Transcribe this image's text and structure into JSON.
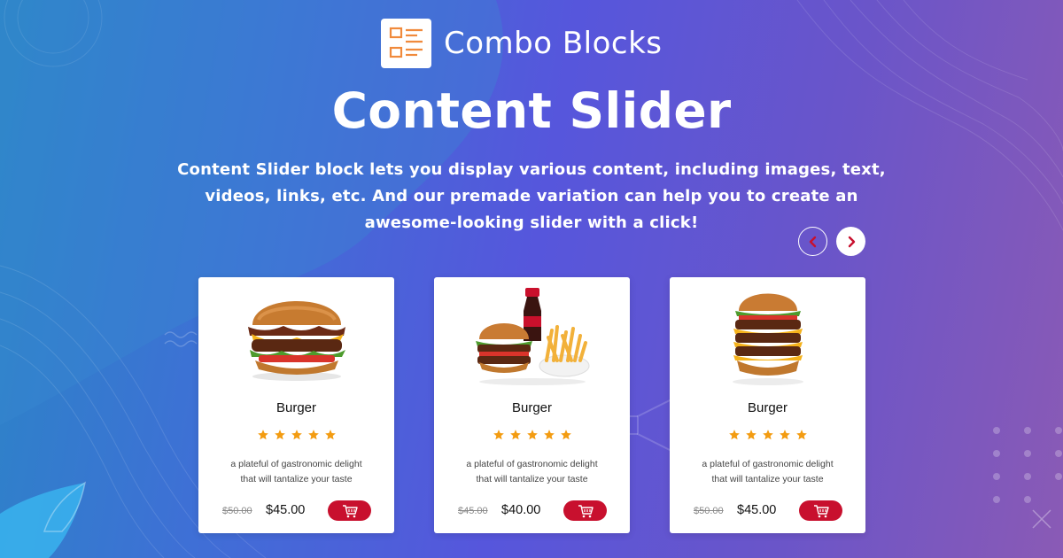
{
  "brand": {
    "name": "Combo Blocks",
    "logo_icon": "layout-blocks-icon"
  },
  "hero": {
    "title": "Content Slider",
    "description": "Content Slider block lets you display various content, including images, text, videos, links, etc. And our premade variation can help you to create an awesome-looking slider with a click!"
  },
  "slider_nav": {
    "prev_icon": "chevron-left-icon",
    "next_icon": "chevron-right-icon"
  },
  "colors": {
    "accent": "#c8102e",
    "star": "#f39c12",
    "card_bg": "#ffffff"
  },
  "cards": [
    {
      "title": "Burger",
      "rating": 5,
      "description_line1": "a plateful of gastronomic delight",
      "description_line2": "that will tantalize your taste",
      "old_price": "$50.00",
      "price": "$45.00",
      "image": "bacon-burger-image"
    },
    {
      "title": "Burger",
      "rating": 5,
      "description_line1": "a plateful of gastronomic delight",
      "description_line2": "that will tantalize your taste",
      "old_price": "$45.00",
      "price": "$40.00",
      "image": "burger-combo-image"
    },
    {
      "title": "Burger",
      "rating": 5,
      "description_line1": "a plateful of gastronomic delight",
      "description_line2": "that will tantalize your taste",
      "old_price": "$50.00",
      "price": "$45.00",
      "image": "triple-burger-image"
    }
  ]
}
